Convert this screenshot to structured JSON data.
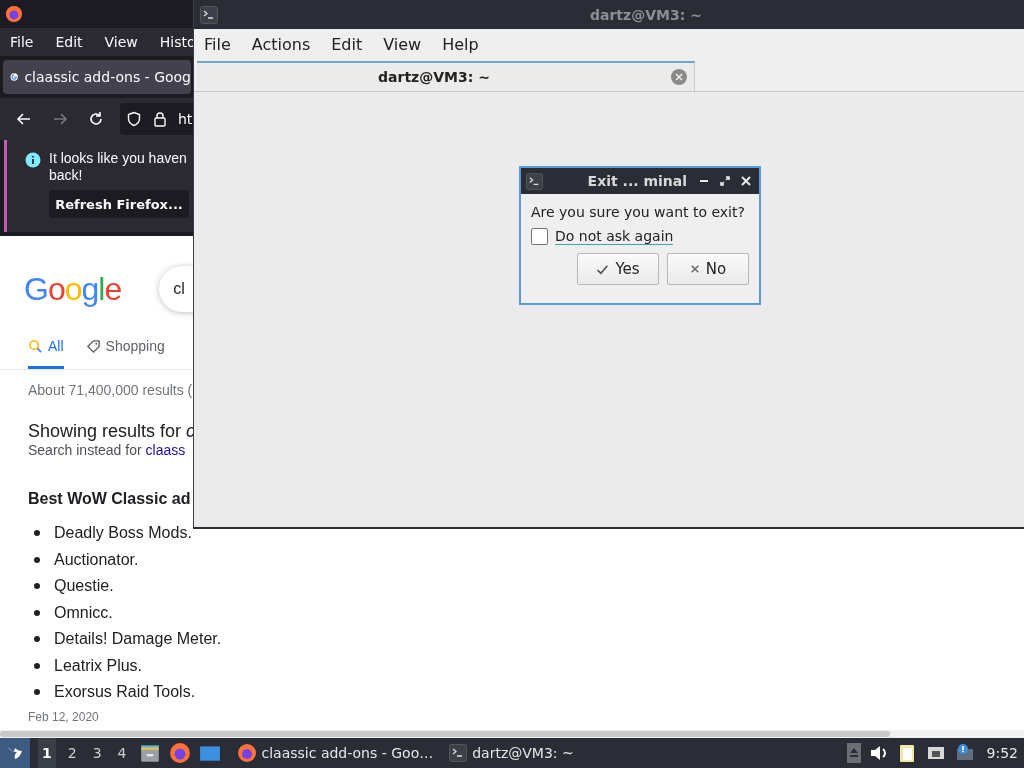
{
  "firefox": {
    "menu": [
      "File",
      "Edit",
      "View",
      "Histo"
    ],
    "tab_title": "claassic add-ons - Goog",
    "url": "ht",
    "notification": {
      "text": "It looks like you haven",
      "text_line2": "back!",
      "button": "Refresh Firefox..."
    },
    "logo": "Google",
    "search_query": "cl",
    "tabs": [
      {
        "label": "All",
        "kind": "search",
        "selected": true
      },
      {
        "label": "Shopping",
        "kind": "tag",
        "selected": false
      }
    ],
    "result_stats": "About 71,400,000 results (",
    "showing": "Showing results for *c*",
    "search_instead": {
      "text": "Search instead for",
      "link": "claass"
    },
    "heading": "Best WoW Classic ad",
    "items": [
      "Deadly Boss Mods.",
      "Auctionator.",
      "Questie.",
      "Omnicc.",
      "Details! Damage Meter.",
      "Leatrix Plus.",
      "Exorsus Raid Tools."
    ],
    "date": "Feb 12, 2020"
  },
  "terminal": {
    "title": "dartz@VM3: ~",
    "menu": [
      "File",
      "Actions",
      "Edit",
      "View",
      "Help"
    ],
    "tab_title": "dartz@VM3: ~"
  },
  "dialog": {
    "title": "Exit ... minal",
    "message": "Are you sure you want to exit?",
    "checkbox": {
      "label": "Do not ask again",
      "checked": false
    },
    "buttons": [
      {
        "label": "Yes",
        "kind": "yes"
      },
      {
        "label": "No",
        "kind": "no"
      }
    ]
  },
  "taskbar": {
    "workspaces": [
      {
        "label": "1",
        "selected": true
      },
      {
        "label": "2",
        "selected": false
      },
      {
        "label": "3",
        "selected": false
      },
      {
        "label": "4",
        "selected": false
      }
    ],
    "tasks": [
      {
        "label": "claassic add-ons - Goo…",
        "kind": "firefox"
      },
      {
        "label": "dartz@VM3: ~",
        "kind": "terminal"
      }
    ],
    "clock": "9:52"
  }
}
